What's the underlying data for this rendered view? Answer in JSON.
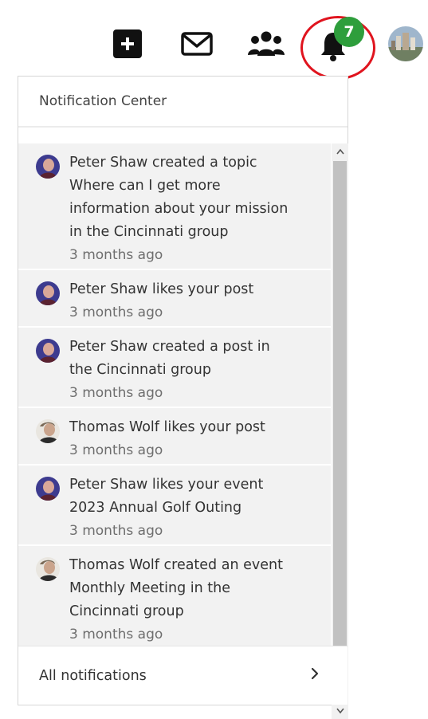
{
  "toolbar": {
    "notification_count": "7",
    "icons": [
      "plus-icon",
      "mail-icon",
      "people-icon",
      "bell-icon"
    ],
    "badge_color": "#2e9e3c",
    "highlight_color": "#e0141e"
  },
  "notification_center": {
    "title": "Notification Center",
    "footer_label": "All notifications",
    "items": [
      {
        "user": "Peter Shaw",
        "text": "Peter Shaw created a topic\nWhere can I get more\ninformation about your mission\nin the Cincinnati group",
        "time": "3 months ago"
      },
      {
        "user": "Peter Shaw",
        "text": "Peter Shaw likes your post",
        "time": "3 months ago"
      },
      {
        "user": "Peter Shaw",
        "text": "Peter Shaw created a post in\nthe Cincinnati group",
        "time": "3 months ago"
      },
      {
        "user": "Thomas Wolf",
        "text": "Thomas Wolf likes your post",
        "time": "3 months ago"
      },
      {
        "user": "Peter Shaw",
        "text": "Peter Shaw likes your event\n2023 Annual Golf Outing",
        "time": "3 months ago"
      },
      {
        "user": "Thomas Wolf",
        "text": "Thomas Wolf created an event\nMonthly Meeting in the\nCincinnati group",
        "time": "3 months ago"
      }
    ]
  }
}
